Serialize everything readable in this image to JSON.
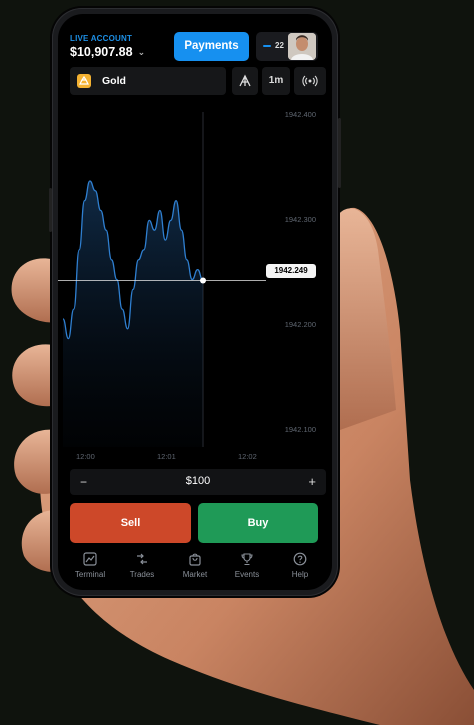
{
  "account": {
    "label": "LIVE ACCOUNT",
    "balance": "$10,907.88"
  },
  "header": {
    "payments_label": "Payments",
    "notifications_count": "22"
  },
  "asset": {
    "name": "Gold",
    "timeframe": "1m"
  },
  "chart_data": {
    "type": "line",
    "x": [
      "12:00",
      "12:00",
      "12:00",
      "12:00",
      "12:00",
      "12:00",
      "12:00",
      "12:00",
      "12:00",
      "12:00",
      "12:00",
      "12:00",
      "12:01",
      "12:01",
      "12:01",
      "12:01",
      "12:01",
      "12:01",
      "12:01",
      "12:01",
      "12:01",
      "12:01",
      "12:01",
      "12:01",
      "12:01",
      "12:01",
      "12:01"
    ],
    "values": [
      1942.21,
      1942.19,
      1942.22,
      1942.28,
      1942.33,
      1942.35,
      1942.34,
      1942.32,
      1942.3,
      1942.27,
      1942.25,
      1942.22,
      1942.2,
      1942.24,
      1942.27,
      1942.28,
      1942.31,
      1942.3,
      1942.32,
      1942.29,
      1942.31,
      1942.33,
      1942.3,
      1942.27,
      1942.25,
      1942.26,
      1942.249
    ],
    "y_ticks": [
      "1942.400",
      "1942.300",
      "1942.200",
      "1942.100"
    ],
    "x_ticks": [
      "12:00",
      "12:01",
      "12:02"
    ],
    "ylim": [
      1942.08,
      1942.42
    ],
    "current_price": "1942.249",
    "grid": false
  },
  "trade": {
    "minus": "−",
    "amount": "$100",
    "plus": "+",
    "sell_label": "Sell",
    "buy_label": "Buy"
  },
  "nav": [
    {
      "label": "Terminal",
      "icon": "chart-icon"
    },
    {
      "label": "Trades",
      "icon": "arrows-icon"
    },
    {
      "label": "Market",
      "icon": "bag-icon"
    },
    {
      "label": "Events",
      "icon": "trophy-icon"
    },
    {
      "label": "Help",
      "icon": "help-icon"
    }
  ],
  "colors": {
    "accent": "#1690f0",
    "sell": "#cd4829",
    "buy": "#1f9a57",
    "line": "#2f7fd0"
  }
}
